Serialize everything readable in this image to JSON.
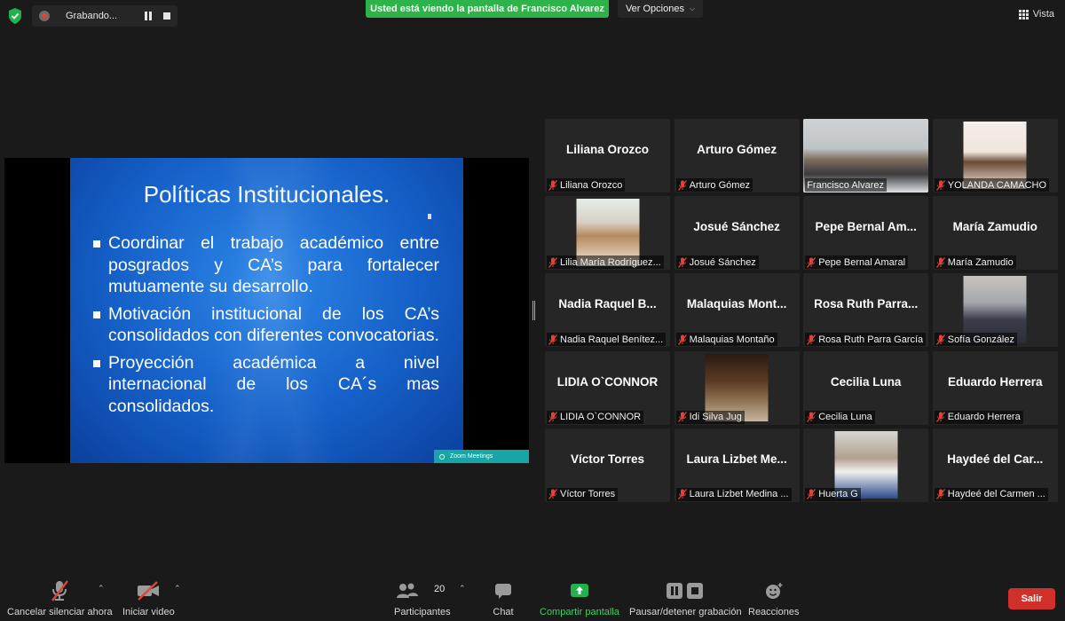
{
  "top_bar": {
    "recording_label": "Grabando...",
    "viewing_banner": "Usted está viendo la pantalla de Francisco Alvarez",
    "view_options_label": "Ver Opciones",
    "view_label": "Vista"
  },
  "shared_screen": {
    "slide_title": "Políticas Institucionales.",
    "bullets": [
      "Coordinar el trabajo académico entre posgrados y CA’s para fortalecer mutuamente su desarrollo.",
      "Motivación institucional de los CA’s consolidados con diferentes convocatorias.",
      "Proyección académica a nivel internacional de los CA´s mas consolidados."
    ],
    "mini_window_label": "Zoom Meetings"
  },
  "participants": [
    {
      "center": "Liliana Orozco",
      "label": "Liliana Orozco",
      "video": false
    },
    {
      "center": "Arturo Gómez",
      "label": "Arturo Gómez",
      "video": false
    },
    {
      "center": "",
      "label": "Francisco Alvarez",
      "video": true,
      "active": true
    },
    {
      "center": "",
      "label": "YOLANDA CAMACHO",
      "video": true
    },
    {
      "center": "",
      "label": "Lilia María Rodríguez...",
      "video": true
    },
    {
      "center": "Josué Sánchez",
      "label": "Josué Sánchez",
      "video": false
    },
    {
      "center": "Pepe Bernal Am...",
      "label": "Pepe Bernal Amaral",
      "video": false
    },
    {
      "center": "María Zamudio",
      "label": "María Zamudio",
      "video": false
    },
    {
      "center": "Nadia Raquel B...",
      "label": "Nadia Raquel Benítez...",
      "video": false
    },
    {
      "center": "Malaquias Mont...",
      "label": "Malaquias Montaño",
      "video": false
    },
    {
      "center": "Rosa Ruth Parra...",
      "label": "Rosa Ruth Parra García",
      "video": false
    },
    {
      "center": "",
      "label": "Sofía González",
      "video": true
    },
    {
      "center": "LIDIA O`CONNOR",
      "label": "LIDIA O`CONNOR",
      "video": false
    },
    {
      "center": "",
      "label": "Idi Silva Jug",
      "video": true
    },
    {
      "center": "Cecilia Luna",
      "label": "Cecilia Luna",
      "video": false
    },
    {
      "center": "Eduardo Herrera",
      "label": "Eduardo Herrera",
      "video": false
    },
    {
      "center": "Víctor Torres",
      "label": "Víctor Torres",
      "video": false
    },
    {
      "center": "Laura Lizbet Me...",
      "label": "Laura Lizbet Medina ...",
      "video": false
    },
    {
      "center": "",
      "label": "Huerta G",
      "video": true
    },
    {
      "center": "Haydeé del Car...",
      "label": "Haydeé del Carmen ...",
      "video": false
    }
  ],
  "toolbar": {
    "unmute_label": "Cancelar silenciar ahora",
    "video_label": "Iniciar video",
    "participants_label": "Participantes",
    "participants_count": "20",
    "chat_label": "Chat",
    "share_label": "Compartir pantalla",
    "record_label": "Pausar/detener grabación",
    "reactions_label": "Reacciones",
    "leave_label": "Salir"
  },
  "colors": {
    "banner_green": "#2db34a",
    "active_speaker": "#c8e97a",
    "leave_red": "#d0302a",
    "muted_red": "#e0433a"
  }
}
